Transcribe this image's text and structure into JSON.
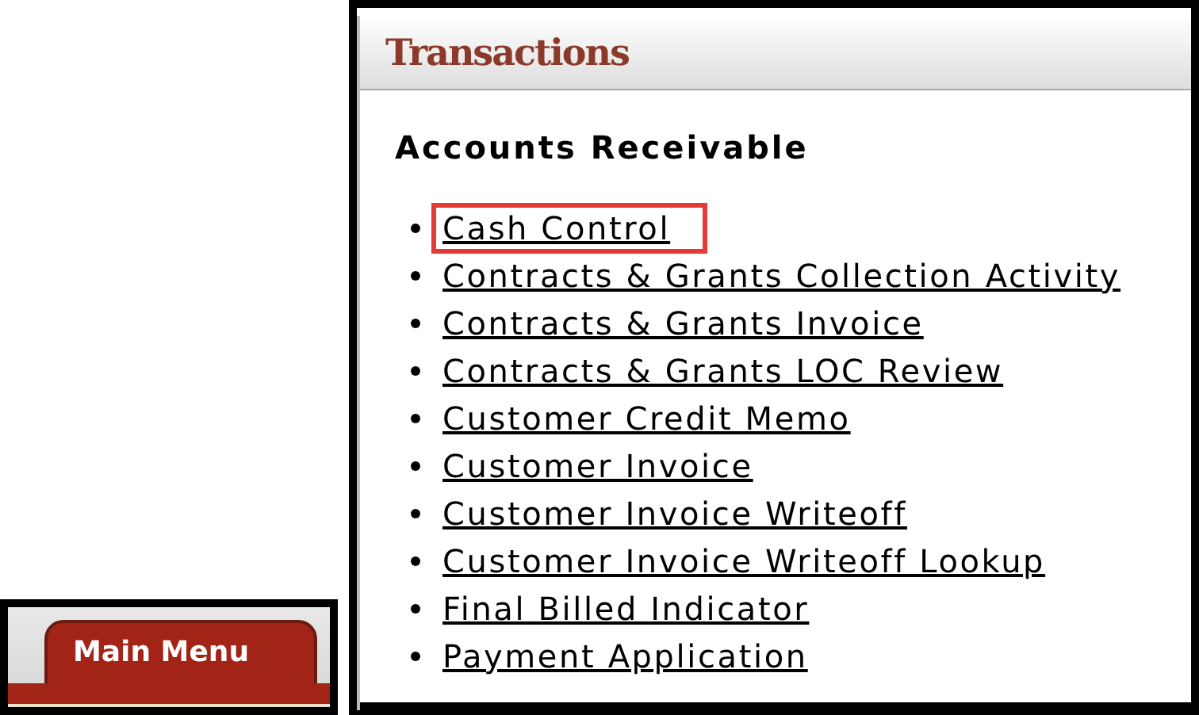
{
  "main_menu_tab": {
    "label": "Main Menu",
    "selected": true
  },
  "panel": {
    "title": "Transactions",
    "section_heading": "Accounts Receivable",
    "links": [
      {
        "label": "Cash Control",
        "highlighted": true
      },
      {
        "label": "Contracts & Grants Collection Activity",
        "highlighted": false
      },
      {
        "label": "Contracts & Grants Invoice",
        "highlighted": false
      },
      {
        "label": "Contracts & Grants LOC Review",
        "highlighted": false
      },
      {
        "label": "Customer Credit Memo",
        "highlighted": false
      },
      {
        "label": "Customer Invoice",
        "highlighted": false
      },
      {
        "label": "Customer Invoice Writeoff",
        "highlighted": false
      },
      {
        "label": "Customer Invoice Writeoff Lookup",
        "highlighted": false
      },
      {
        "label": "Final Billed Indicator",
        "highlighted": false
      },
      {
        "label": "Payment Application",
        "highlighted": false
      }
    ]
  }
}
